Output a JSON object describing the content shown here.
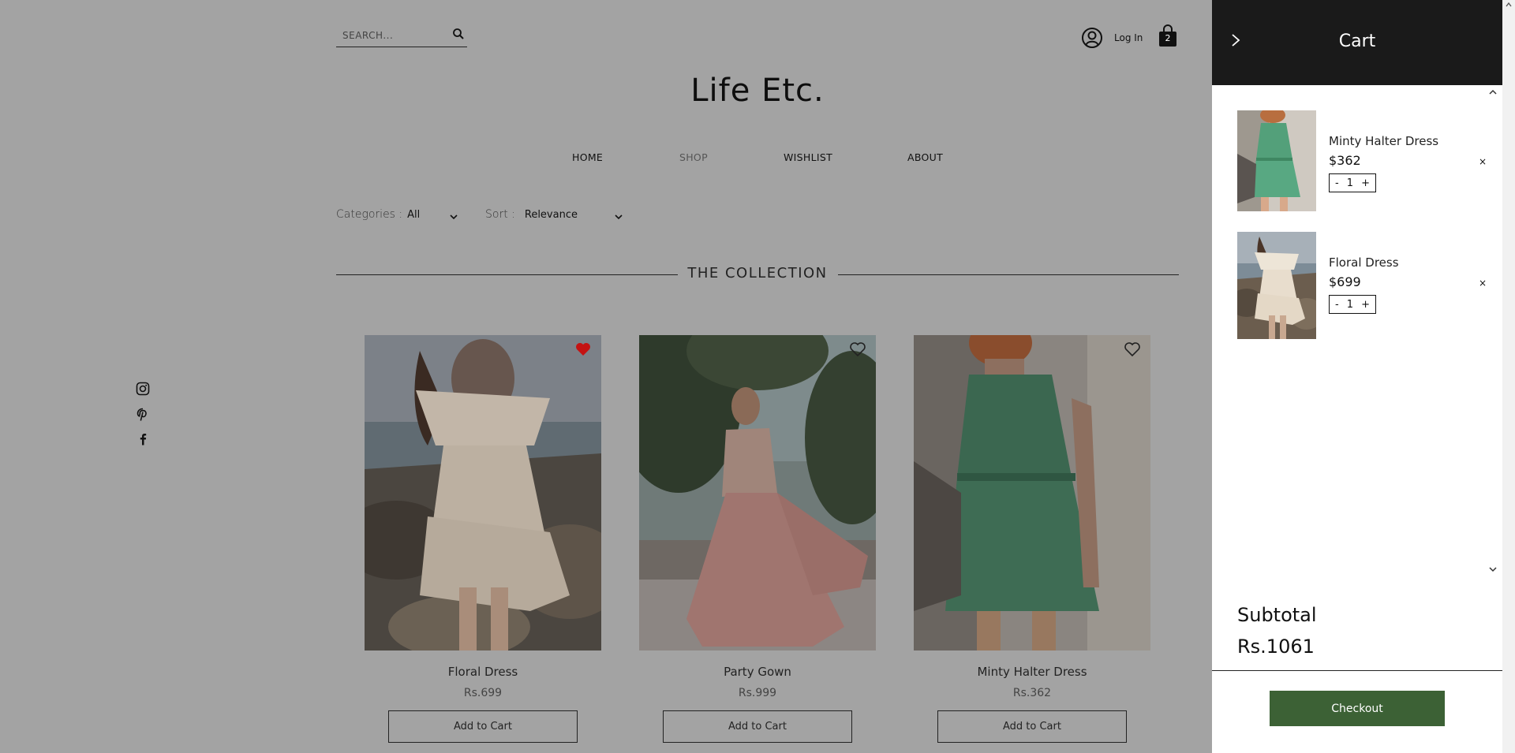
{
  "search": {
    "placeholder": "SEARCH..."
  },
  "header": {
    "login_label": "Log In",
    "cart_count": "2",
    "brand": "Life Etc."
  },
  "nav": {
    "items": [
      "HOME",
      "SHOP",
      "WISHLIST",
      "ABOUT"
    ],
    "active": "SHOP"
  },
  "filters": {
    "categories_label": "Categories :",
    "categories_value": "All",
    "sort_label": "Sort :",
    "sort_value": "Relevance"
  },
  "collection": {
    "title": "THE COLLECTION",
    "products": [
      {
        "name": "Floral Dress",
        "price": "Rs.699",
        "button": "Add to Cart",
        "wishlisted": true
      },
      {
        "name": "Party Gown",
        "price": "Rs.999",
        "button": "Add to Cart",
        "wishlisted": false
      },
      {
        "name": "Minty Halter Dress",
        "price": "Rs.362",
        "button": "Add to Cart",
        "wishlisted": false
      }
    ]
  },
  "social": [
    "instagram-icon",
    "pinterest-icon",
    "facebook-icon"
  ],
  "cart": {
    "title": "Cart",
    "items": [
      {
        "name": "Minty Halter Dress",
        "price": "$362",
        "qty": "1",
        "minus": "-",
        "plus": "+",
        "remove": "×"
      },
      {
        "name": "Floral Dress",
        "price": "$699",
        "qty": "1",
        "minus": "-",
        "plus": "+",
        "remove": "×"
      }
    ],
    "subtotal_label": "Subtotal",
    "subtotal_value": "Rs.1061",
    "checkout_label": "Checkout"
  },
  "colors": {
    "overlay_bg": "#a3a3a3",
    "cart_header": "#1a1a1a",
    "checkout": "#3c6135",
    "heart_active": "#c41212"
  }
}
